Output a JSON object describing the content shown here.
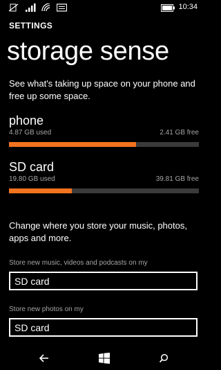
{
  "status_bar": {
    "time": "10:34",
    "icons": [
      "no-sim-icon",
      "signal-icon",
      "wifi-icon",
      "message-icon",
      "battery-icon"
    ]
  },
  "app_title": "SETTINGS",
  "page_title": "storage sense",
  "intro": "See what's taking up space on your phone and free up some space.",
  "storage": [
    {
      "name": "phone",
      "used": "4.87 GB used",
      "free": "2.41 GB free",
      "fill_fraction": 0.669
    },
    {
      "name": "SD card",
      "used": "19.80 GB used",
      "free": "39.81 GB free",
      "fill_fraction": 0.332
    }
  ],
  "change_text": "Change where you store your music, photos, apps and more.",
  "locations": [
    {
      "label": "Store new music, videos and podcasts on my",
      "value": "SD card"
    },
    {
      "label": "Store new photos on my",
      "value": "SD card"
    }
  ],
  "nav": [
    "back-icon",
    "windows-start-icon",
    "search-icon"
  ],
  "colors": {
    "accent": "#f3731f",
    "background": "#000000",
    "track": "#3a3a3a"
  }
}
